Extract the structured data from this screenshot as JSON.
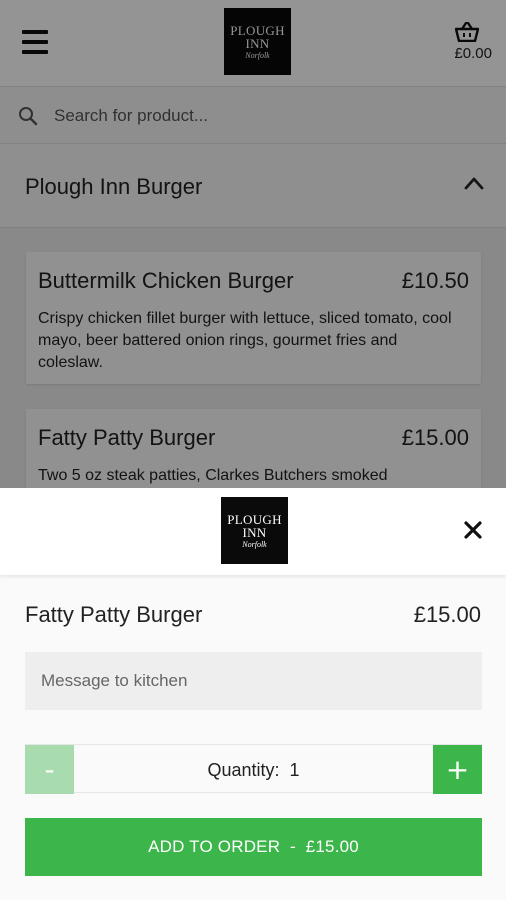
{
  "header": {
    "logo": {
      "line1": "PLOUGH",
      "line2": "INN",
      "line3": "Norfolk"
    },
    "cart_total": "£0.00"
  },
  "search": {
    "placeholder": "Search for product..."
  },
  "category": {
    "title": "Plough Inn Burger"
  },
  "items": [
    {
      "name": "Buttermilk Chicken Burger",
      "price": "£10.50",
      "description": "Crispy chicken fillet burger with lettuce, sliced tomato, cool mayo, beer battered onion rings, gourmet fries and coleslaw."
    },
    {
      "name": "Fatty Patty Burger",
      "price": "£15.00",
      "description": "Two 5 oz steak patties, Clarkes Butchers smoked"
    }
  ],
  "modal": {
    "item_name": "Fatty Patty Burger",
    "item_price": "£15.00",
    "message_placeholder": "Message to kitchen",
    "quantity_label": "Quantity:",
    "quantity_value": "1",
    "minus_label": "-",
    "plus_label": "+",
    "add_button_label": "ADD TO ORDER  -  £15.00"
  },
  "colors": {
    "accent": "#3cb54a",
    "accent_disabled": "#a8dcae"
  }
}
